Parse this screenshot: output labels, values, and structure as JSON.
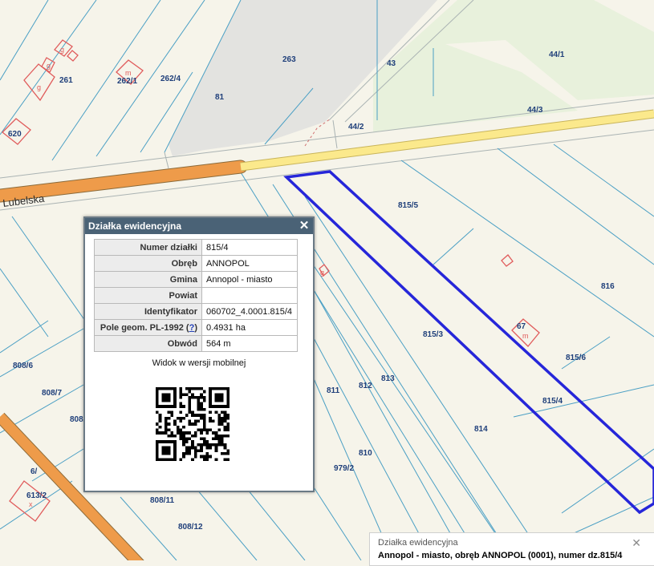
{
  "map": {
    "street_name": "Lubelska",
    "parcel_labels": [
      "263",
      "43",
      "44/1",
      "44/3",
      "44/2",
      "261",
      "262/1",
      "262/4",
      "81",
      "620",
      "815/5",
      "816",
      "815/3",
      "815/6",
      "815/4",
      "814",
      "813",
      "812",
      "811",
      "810",
      "979/2",
      "808/6",
      "808/7",
      "808/",
      "808/11",
      "808/12",
      "613/2",
      "6/",
      "67"
    ],
    "building_symbols": [
      "g",
      "g",
      "g",
      "m",
      "g",
      "m",
      "x"
    ]
  },
  "popup": {
    "title": "Działka ewidencyjna",
    "close_glyph": "✕",
    "rows": [
      {
        "label": "Numer działki",
        "value": "815/4"
      },
      {
        "label": "Obręb",
        "value": "ANNOPOL"
      },
      {
        "label": "Gmina",
        "value": "Annopol - miasto"
      },
      {
        "label": "Powiat",
        "value": ""
      },
      {
        "label": "Identyfikator",
        "value": "060702_4.0001.815/4"
      },
      {
        "label": "Pole geom. PL-1992",
        "help": "?",
        "value": "0.4931 ha"
      },
      {
        "label": "Obwód",
        "value": "564 m"
      }
    ],
    "mobile_text": "Widok w wersji mobilnej"
  },
  "info_bar": {
    "title": "Działka ewidencyjna",
    "line": "Annopol - miasto, obręb ANNOPOL (0001), numer dz.815/4",
    "close_glyph": "✕"
  },
  "colors": {
    "parcel_line": "#4a9fc4",
    "selection": "#2626d9",
    "main_road": "#ee9b4a",
    "secondary_road": "#fbe98c",
    "building": "#e05b5b",
    "green_area": "#e8f1dc",
    "gray_area": "#e3e3e0"
  }
}
